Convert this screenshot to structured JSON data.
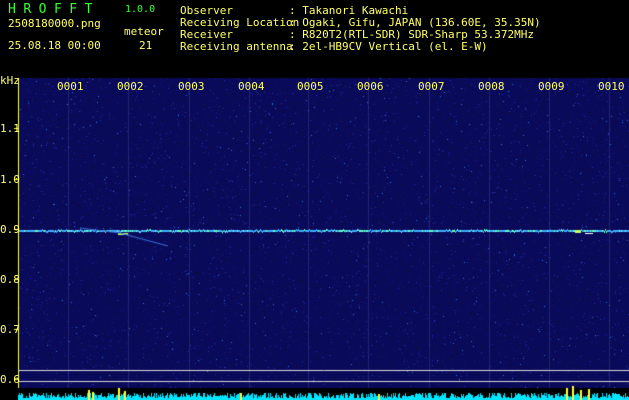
{
  "app": {
    "title": "HROFFT",
    "version": "1.0.0"
  },
  "file": {
    "name": "2508180000.png",
    "datetime": "25.08.18 00:00"
  },
  "meteor": {
    "label": "meteor",
    "count": "21"
  },
  "info": {
    "labels": [
      "Observer",
      "Receiving Location",
      "Receiver",
      "Receiving antenna"
    ],
    "values": [
      ": Takanori Kawachi",
      ": Ogaki, Gifu, JAPAN (136.60E, 35.35N)",
      ": R820T2(RTL-SDR) SDR-Sharp 53.372MHz",
      ": 2el-HB9CV Vertical (el. E-W)"
    ]
  },
  "axis": {
    "unit": "kHz",
    "y_ticks": [
      "1.1",
      "1.0",
      "0.9",
      "0.8",
      "0.7",
      "0.6"
    ],
    "x_ticks": [
      "0001",
      "0002",
      "0003",
      "0004",
      "0005",
      "0006",
      "0007",
      "0008",
      "0009",
      "0010"
    ]
  },
  "colors": {
    "background": "#000000",
    "plot_bg": "#0a0a5a",
    "text_yellow": "#ffff66",
    "title_green": "#33ff33",
    "signal": "#66ffcc",
    "noise_bottom": "#00e5ff"
  }
}
